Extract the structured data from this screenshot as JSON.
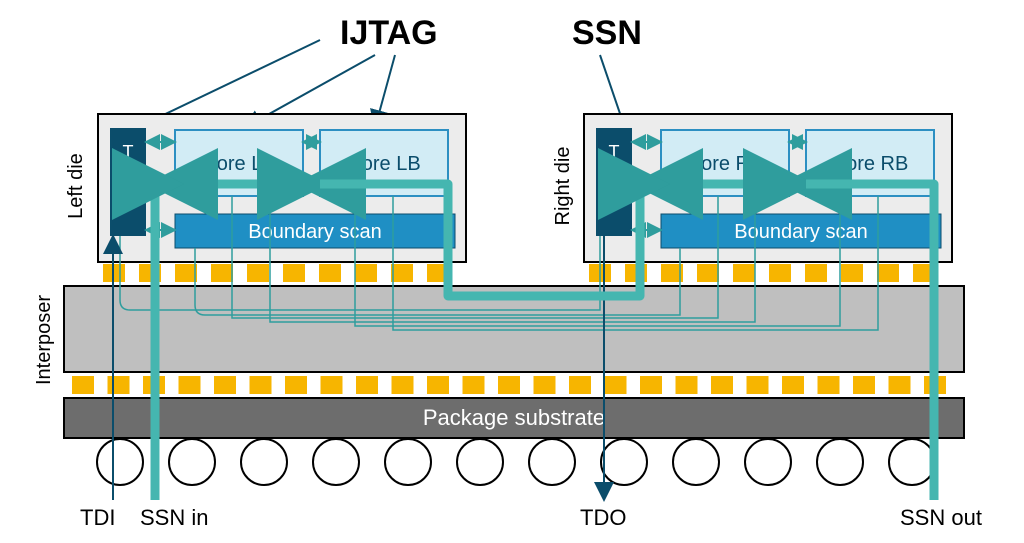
{
  "labels": {
    "ijtag": "IJTAG",
    "ssn": "SSN",
    "left_die": "Left die",
    "right_die": "Right die",
    "interposer": "Interposer",
    "tap": "T\nA\nP",
    "core_la": "Core LA",
    "core_lb": "Core LB",
    "core_ra": "Core RA",
    "core_rb": "Core RB",
    "boundary_scan": "Boundary scan",
    "package_substrate": "Package substrate",
    "tdi": "TDI",
    "ssn_in": "SSN in",
    "tdo": "TDO",
    "ssn_out": "SSN out"
  },
  "colors": {
    "teal": "#2f9d9d",
    "teal_thick": "#45b6b0",
    "dark_blue": "#0b4d6b",
    "core_fill": "#d2ecf5",
    "core_stroke": "#2c8fc2",
    "bscan_fill": "#1f8fc4",
    "die_fill": "#ececec",
    "interposer_fill": "#bfbfbf",
    "substrate_fill": "#6d6d6d",
    "gold": "#f7b500",
    "black": "#000000",
    "white": "#ffffff"
  },
  "package_balls": 12,
  "bumps_top_each": 10,
  "bumps_bottom": 25
}
